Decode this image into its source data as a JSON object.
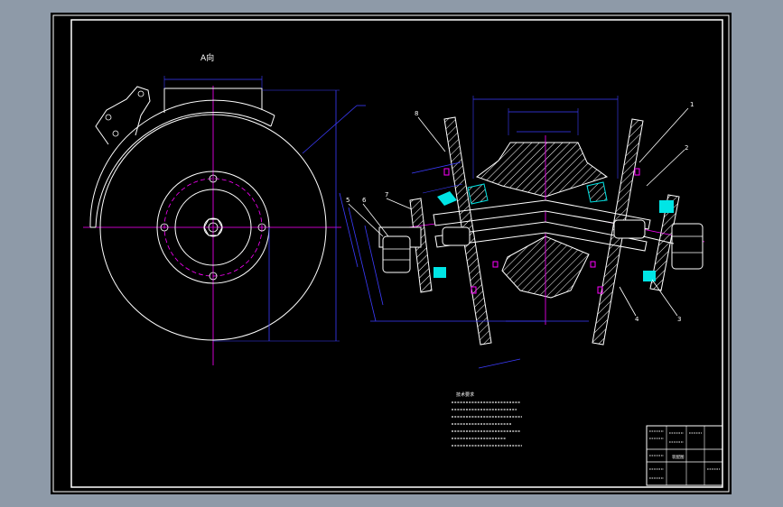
{
  "drawing": {
    "view_label": "A向",
    "background_color": "#000000",
    "frame_color": "#ffffff",
    "center_line_color": "#ff00ff",
    "dimension_color": "#3c3cff",
    "hatch_color": "#ffffff",
    "cyan_part_color": "#00e5e5",
    "part_labels": [
      "1",
      "2",
      "3",
      "4",
      "5",
      "6",
      "7",
      "8"
    ],
    "notes_heading": "技术要求",
    "title_block_label": "装配图"
  }
}
